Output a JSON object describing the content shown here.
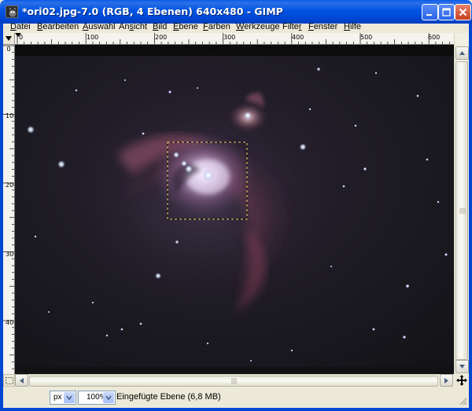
{
  "window": {
    "title": "*ori02.jpg-7.0 (RGB, 4 Ebenen) 640x480 - GIMP",
    "icons": {
      "app": "gimp-icon",
      "minimize": "minimize-icon",
      "maximize": "maximize-icon",
      "close": "close-icon"
    }
  },
  "menu": {
    "items": [
      {
        "label": "Datei",
        "accel": "D",
        "rest": "atei"
      },
      {
        "label": "Bearbeiten",
        "accel": "B",
        "rest": "earbeiten"
      },
      {
        "label": "Auswahl",
        "accel": "A",
        "rest": "uswahl"
      },
      {
        "label": "Ansicht",
        "pre": "An",
        "accel": "s",
        "rest": "icht"
      },
      {
        "label": "Bild",
        "accel": "B",
        "rest": "ild"
      },
      {
        "label": "Ebene",
        "accel": "E",
        "rest": "bene"
      },
      {
        "label": "Farben",
        "accel": "F",
        "rest": "arben"
      },
      {
        "label": "Werkzeuge",
        "accel": "W",
        "rest": "erkzeuge"
      },
      {
        "label": "Filter",
        "pre": "Filte",
        "accel": "r",
        "rest": ""
      },
      {
        "label": "Fenster",
        "accel": "F",
        "rest": "enster"
      },
      {
        "label": "Hilfe",
        "accel": "H",
        "rest": "ilfe"
      }
    ]
  },
  "rulers": {
    "horizontal_labels": [
      "0",
      "100",
      "200",
      "300",
      "400",
      "500",
      "600"
    ],
    "vertical_labels": [
      "0",
      "100",
      "200",
      "300",
      "400"
    ]
  },
  "statusbar": {
    "unit": "px",
    "zoom": "100%",
    "layer_info": "Eingefügte Ebene (6,8 MB)"
  },
  "canvas": {
    "image": "orion-nebula-photo",
    "selection": "rectangle-selection"
  },
  "colors": {
    "titlebar": "#0054e3",
    "chrome": "#ece9d8",
    "selection_marquee": "#e8d060",
    "nebula_core": "#f4e8ff",
    "nebula_glow": "#a8506a"
  }
}
